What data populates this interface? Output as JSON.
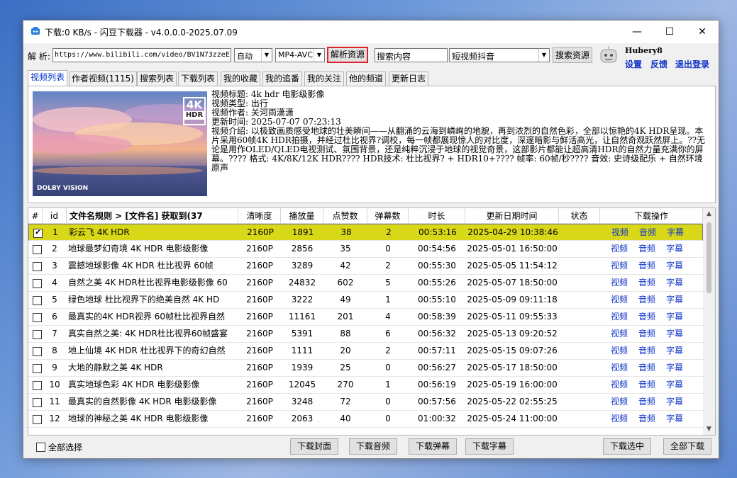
{
  "window": {
    "title": "下载:0 KB/s - 闪豆下载器 - v4.0.0.0-2025.07.09",
    "minimize": "—",
    "maximize": "☐",
    "close": "✕"
  },
  "toolbar": {
    "parse_label": "解 析:",
    "url_value": "https://www.bilibili.com/video/BV1N73zzeE",
    "quality_select": "自动",
    "format_select": "MP4-AVC",
    "parse_button": "解析资源",
    "search_value": "搜索内容",
    "search_source_select": "短视频抖音",
    "search_button": "搜索资源"
  },
  "user": {
    "name": "Hubery8",
    "settings": "设置",
    "feedback": "反馈",
    "logout": "退出登录"
  },
  "tabs": [
    "视频列表",
    "作者视频(1115)",
    "搜索列表",
    "下载列表",
    "我的收藏",
    "我的追番",
    "我的关注",
    "他的频道",
    "更新日志"
  ],
  "video_info": {
    "badge": "4K",
    "badge_sub": "HDR",
    "dolby": "DOLBY VISION",
    "title_line": "视频标题: 4k hdr 电影级影像",
    "type_line": "视频类型: 出行",
    "author_line": "视频作者: 关河雨潇潇",
    "time_line": "更新时间: 2025-07-07 07:23:13",
    "desc_line": "视频介绍: 以极致画质感受地球的壮美瞬间——从翻涌的云海到嶙峋的地貌，再到浓烈的自然色彩，全部以惊艳的4K HDR呈现。本片采用60帧4K HDR拍摄，并经过杜比视界?调校，每一帧都展现惊人的对比度，深邃暗影与鲜活高光，让自然奇观跃然屏上。??无论是用作OLED/QLED电视测试、氛围背景，还是纯粹沉浸于地球的视觉奇景，这部影片都能让超高清HDR的自然力量充满你的屏幕。???? 格式: 4K/8K/12K HDR???? HDR技术: 杜比视界? + HDR10+???? 帧率: 60帧/秒???? 音效: 史诗级配乐 + 自然环境原声"
  },
  "table": {
    "headers": [
      "#",
      "id",
      "文件名规则    >    [文件名]    获取到(37",
      "清晰度",
      "播放量",
      "点赞数",
      "弹幕数",
      "时长",
      "更新日期时间",
      "状态",
      "下载操作"
    ],
    "action_labels": {
      "video": "视频",
      "audio": "音频",
      "subtitle": "字幕"
    },
    "checked_mark": "✔",
    "rows": [
      {
        "checked": true,
        "id": "1",
        "name": "彩云飞    4K HDR",
        "quality": "2160P",
        "plays": "1891",
        "likes": "38",
        "danmaku": "2",
        "duration": "00:53:16",
        "updated": "2025-04-29 10:38:46",
        "status": ""
      },
      {
        "checked": false,
        "id": "2",
        "name": "地球最梦幻奇境    4K HDR 电影级影像",
        "quality": "2160P",
        "plays": "2856",
        "likes": "35",
        "danmaku": "0",
        "duration": "00:54:56",
        "updated": "2025-05-01 16:50:00",
        "status": ""
      },
      {
        "checked": false,
        "id": "3",
        "name": "震撼地球影像    4K HDR 杜比视界    60帧",
        "quality": "2160P",
        "plays": "3289",
        "likes": "42",
        "danmaku": "2",
        "duration": "00:55:30",
        "updated": "2025-05-05 11:54:12",
        "status": ""
      },
      {
        "checked": false,
        "id": "4",
        "name": "自然之美    4K HDR杜比视界电影级影像    60",
        "quality": "2160P",
        "plays": "24832",
        "likes": "602",
        "danmaku": "5",
        "duration": "00:55:26",
        "updated": "2025-05-07 18:50:00",
        "status": ""
      },
      {
        "checked": false,
        "id": "5",
        "name": "绿色地球    杜比视界下的绝美自然    4K HD",
        "quality": "2160P",
        "plays": "3222",
        "likes": "49",
        "danmaku": "1",
        "duration": "00:55:10",
        "updated": "2025-05-09 09:11:18",
        "status": ""
      },
      {
        "checked": false,
        "id": "6",
        "name": "最真实的4K HDR视界    60帧杜比视界自然",
        "quality": "2160P",
        "plays": "11161",
        "likes": "201",
        "danmaku": "4",
        "duration": "00:58:39",
        "updated": "2025-05-11 09:55:33",
        "status": ""
      },
      {
        "checked": false,
        "id": "7",
        "name": "真实自然之美: 4K HDR杜比视界60帧盛宴",
        "quality": "2160P",
        "plays": "5391",
        "likes": "88",
        "danmaku": "6",
        "duration": "00:56:32",
        "updated": "2025-05-13 09:20:52",
        "status": ""
      },
      {
        "checked": false,
        "id": "8",
        "name": "地上仙境    4K HDR    杜比视界下的奇幻自然",
        "quality": "2160P",
        "plays": "1111",
        "likes": "20",
        "danmaku": "2",
        "duration": "00:57:11",
        "updated": "2025-05-15 09:07:26",
        "status": ""
      },
      {
        "checked": false,
        "id": "9",
        "name": "大地的静默之美    4K HDR",
        "quality": "2160P",
        "plays": "1939",
        "likes": "25",
        "danmaku": "0",
        "duration": "00:56:27",
        "updated": "2025-05-17 18:50:00",
        "status": ""
      },
      {
        "checked": false,
        "id": "10",
        "name": "真实地球色彩    4K HDR 电影级影像",
        "quality": "2160P",
        "plays": "12045",
        "likes": "270",
        "danmaku": "1",
        "duration": "00:56:19",
        "updated": "2025-05-19 16:00:00",
        "status": ""
      },
      {
        "checked": false,
        "id": "11",
        "name": "最真实的自然影像    4K HDR 电影级影像",
        "quality": "2160P",
        "plays": "3248",
        "likes": "72",
        "danmaku": "0",
        "duration": "00:57:56",
        "updated": "2025-05-22 02:55:25",
        "status": ""
      },
      {
        "checked": false,
        "id": "12",
        "name": "地球的神秘之美    4K HDR 电影级影像",
        "quality": "2160P",
        "plays": "2063",
        "likes": "40",
        "danmaku": "0",
        "duration": "01:00:32",
        "updated": "2025-05-24 11:00:00",
        "status": ""
      }
    ]
  },
  "footer": {
    "select_all": "全部选择",
    "dl_cover": "下载封面",
    "dl_audio": "下载音频",
    "dl_danmaku": "下载弹幕",
    "dl_subtitle": "下载字幕",
    "dl_selected": "下载选中",
    "dl_all": "全部下载"
  },
  "colors": {
    "selected_row": "#d8d818",
    "link": "#1034c8",
    "parse_border": "#e0202a"
  }
}
